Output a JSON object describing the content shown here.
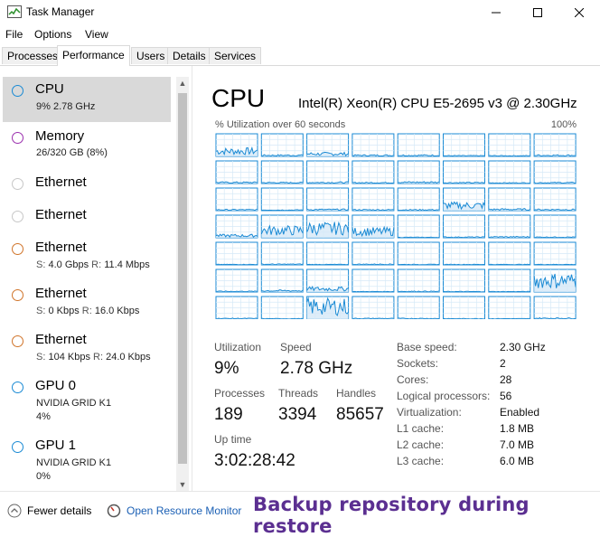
{
  "window": {
    "title": "Task Manager",
    "minimize_icon": "minimize-icon",
    "maximize_icon": "maximize-icon",
    "close_icon": "close-icon"
  },
  "menu": [
    "File",
    "Options",
    "View"
  ],
  "tabs": [
    {
      "label": "Processes",
      "active": false
    },
    {
      "label": "Performance",
      "active": true
    },
    {
      "label": "Users",
      "active": false
    },
    {
      "label": "Details",
      "active": false
    },
    {
      "label": "Services",
      "active": false
    }
  ],
  "resources": [
    {
      "name": "CPU",
      "line1": "9% 2.78 GHz",
      "color": "#1a8ad4",
      "selected": true
    },
    {
      "name": "Memory",
      "line1": "26/320 GB (8%)",
      "color": "#9b2fae"
    },
    {
      "name": "Ethernet",
      "color": "#b9b9b9"
    },
    {
      "name": "Ethernet",
      "color": "#b9b9b9"
    },
    {
      "name": "Ethernet",
      "s": "4.0 Gbps",
      "r": "11.4 Mbps",
      "color": "#d0742a"
    },
    {
      "name": "Ethernet",
      "s": "0 Kbps",
      "r": "16.0 Kbps",
      "color": "#d0742a"
    },
    {
      "name": "Ethernet",
      "s": "104 Kbps",
      "r": "24.0 Kbps",
      "color": "#d0742a"
    },
    {
      "name": "GPU 0",
      "line1": "NVIDIA GRID K1",
      "line2": "4%",
      "color": "#1a8ad4"
    },
    {
      "name": "GPU 1",
      "line1": "NVIDIA GRID K1",
      "line2": "0%",
      "color": "#1a8ad4"
    }
  ],
  "labels": {
    "send": "S:",
    "receive": "R:"
  },
  "cpu": {
    "title": "CPU",
    "model": "Intel(R) Xeon(R) CPU E5-2695 v3 @ 2.30GHz",
    "util_caption": "% Utilization over 60 seconds",
    "util_max": "100%",
    "graph_line_color": "#1a8ad4",
    "graph_fill_color": "#d6e9f7",
    "graph_grid_color": "#d6e9f7",
    "core_levels": [
      0.25,
      0.05,
      0.12,
      0.05,
      0.05,
      0.03,
      0.03,
      0.05,
      0.05,
      0.04,
      0.05,
      0.04,
      0.06,
      0.04,
      0.03,
      0.04,
      0.04,
      0.03,
      0.05,
      0.04,
      0.04,
      0.25,
      0.06,
      0.05,
      0.1,
      0.35,
      0.45,
      0.3,
      0.02,
      0.03,
      0.04,
      0.03,
      0.02,
      0.03,
      0.02,
      0.03,
      0.02,
      0.02,
      0.02,
      0.02,
      0.03,
      0.06,
      0.15,
      0.02,
      0.03,
      0.02,
      0.02,
      0.55,
      0.03,
      0.02,
      0.6,
      0.03,
      0.03,
      0.02,
      0.02,
      0.04
    ]
  },
  "stats": {
    "utilization_label": "Utilization",
    "utilization": "9%",
    "speed_label": "Speed",
    "speed": "2.78 GHz",
    "processes_label": "Processes",
    "processes": "189",
    "threads_label": "Threads",
    "threads": "3394",
    "handles_label": "Handles",
    "handles": "85657",
    "uptime_label": "Up time",
    "uptime": "3:02:28:42"
  },
  "details": [
    {
      "label": "Base speed:",
      "value": "2.30 GHz"
    },
    {
      "label": "Sockets:",
      "value": "2"
    },
    {
      "label": "Cores:",
      "value": "28"
    },
    {
      "label": "Logical processors:",
      "value": "56"
    },
    {
      "label": "Virtualization:",
      "value": "Enabled"
    },
    {
      "label": "L1 cache:",
      "value": "1.8 MB"
    },
    {
      "label": "L2 cache:",
      "value": "7.0 MB"
    },
    {
      "label": "L3 cache:",
      "value": "6.0 MB"
    }
  ],
  "footer": {
    "fewer_details": "Fewer details",
    "resource_monitor": "Open Resource Monitor",
    "caption": "Backup repository during restore"
  }
}
